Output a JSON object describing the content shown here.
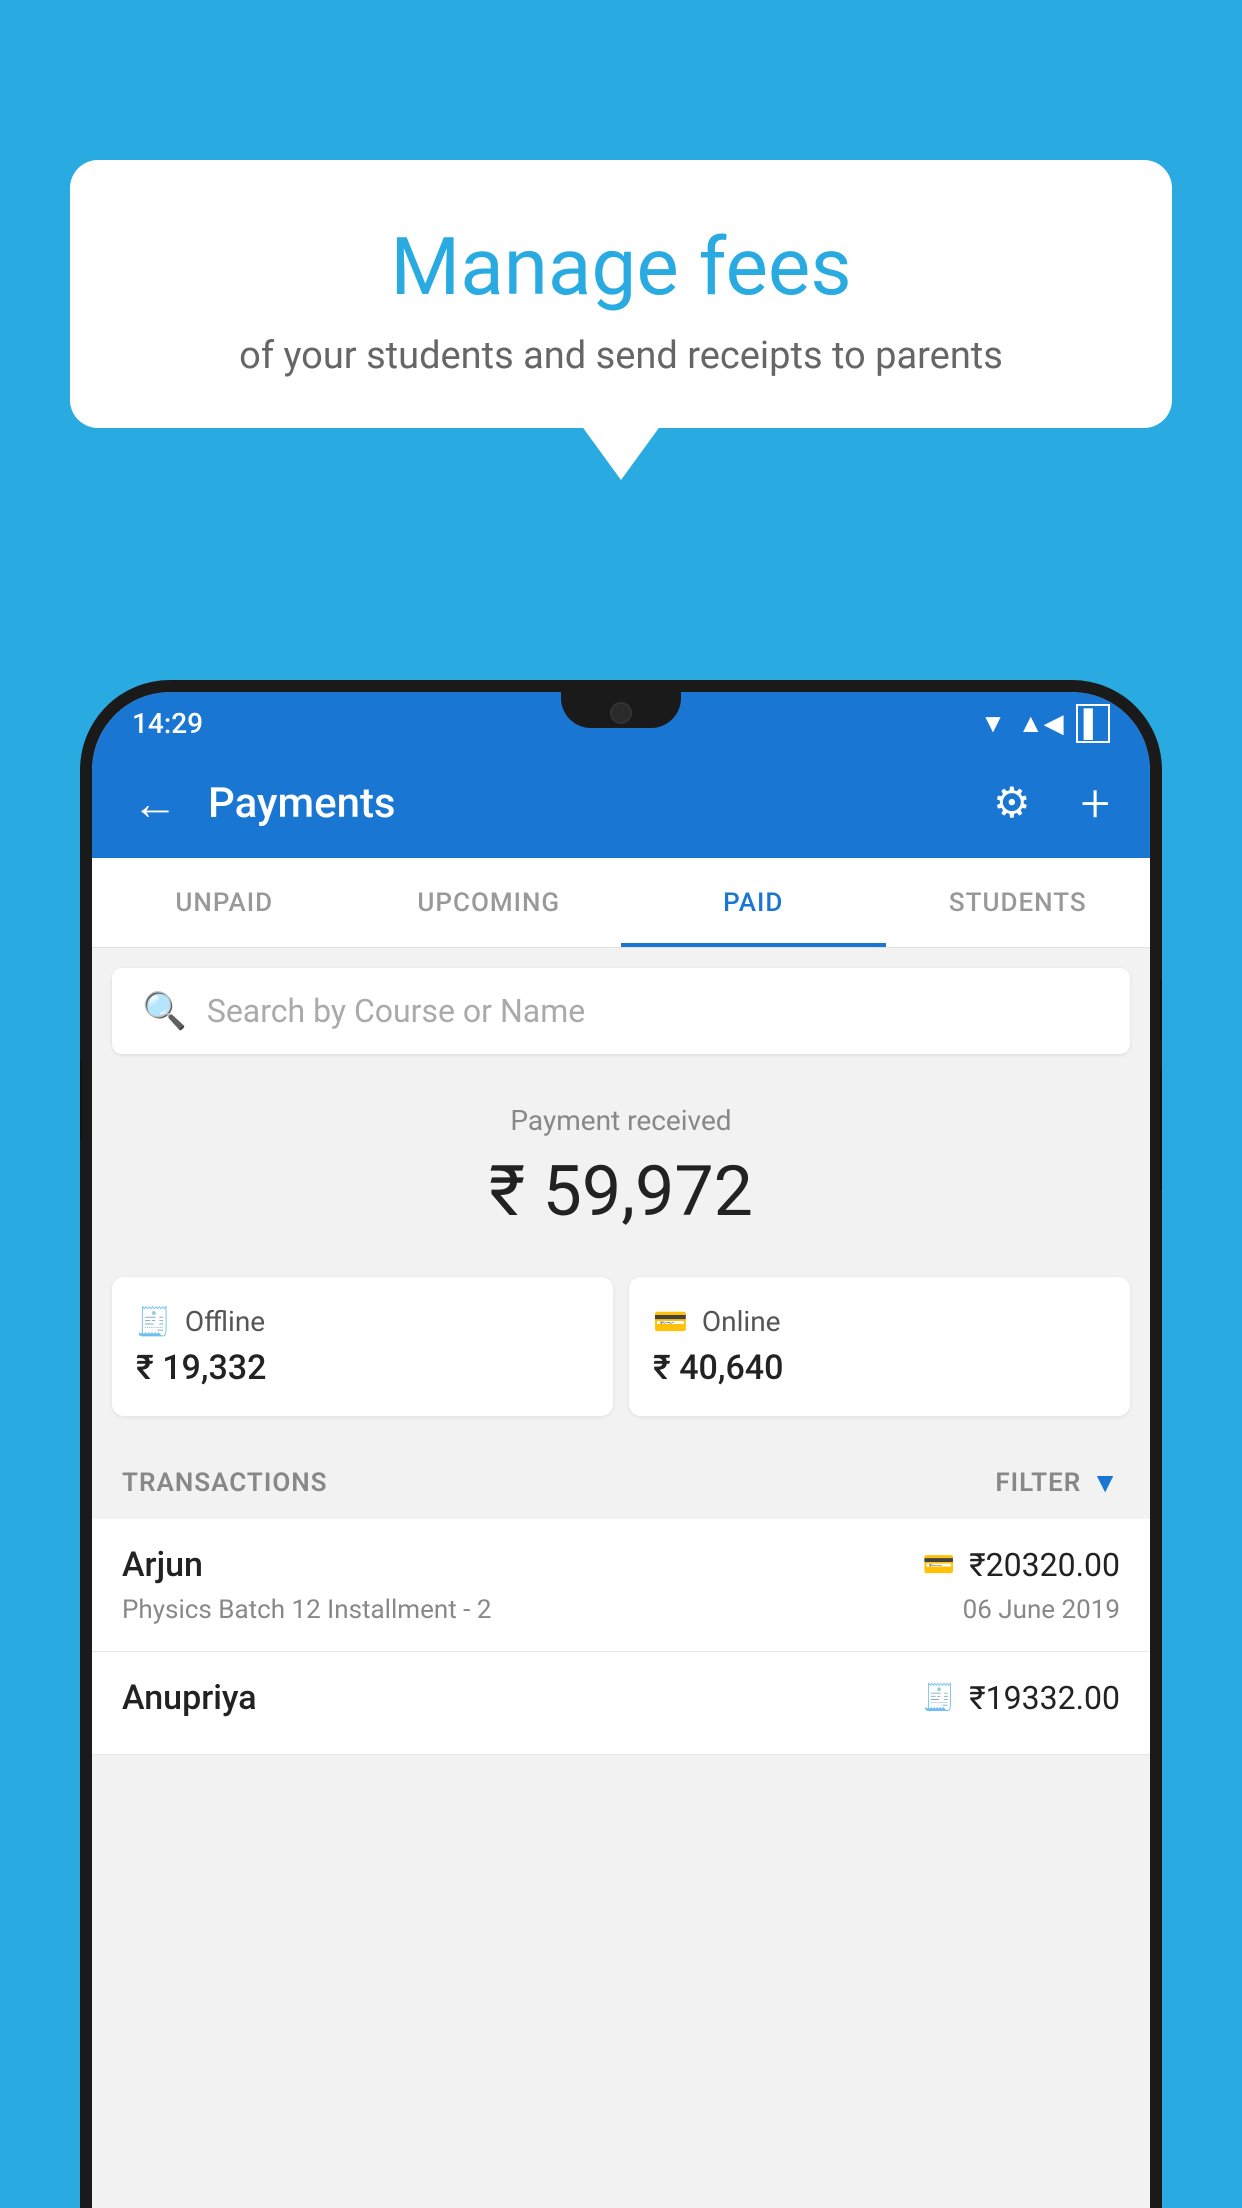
{
  "background_color": "#29abe2",
  "speech_bubble": {
    "title": "Manage fees",
    "subtitle": "of your students and send receipts to parents"
  },
  "status_bar": {
    "time": "14:29",
    "wifi": "▼",
    "signal": "▲",
    "battery": "▌"
  },
  "app_bar": {
    "title": "Payments",
    "back_label": "←",
    "gear_label": "⚙",
    "plus_label": "+"
  },
  "tabs": [
    {
      "label": "UNPAID",
      "active": false
    },
    {
      "label": "UPCOMING",
      "active": false
    },
    {
      "label": "PAID",
      "active": true
    },
    {
      "label": "STUDENTS",
      "active": false
    }
  ],
  "search": {
    "placeholder": "Search by Course or Name"
  },
  "payment_summary": {
    "label": "Payment received",
    "amount": "₹ 59,972",
    "offline": {
      "label": "Offline",
      "amount": "₹ 19,332"
    },
    "online": {
      "label": "Online",
      "amount": "₹ 40,640"
    }
  },
  "transactions": {
    "header_label": "TRANSACTIONS",
    "filter_label": "FILTER",
    "items": [
      {
        "name": "Arjun",
        "amount": "₹20320.00",
        "course": "Physics Batch 12 Installment - 2",
        "date": "06 June 2019",
        "icon": "card"
      },
      {
        "name": "Anupriya",
        "amount": "₹19332.00",
        "course": "",
        "date": "",
        "icon": "cash"
      }
    ]
  }
}
